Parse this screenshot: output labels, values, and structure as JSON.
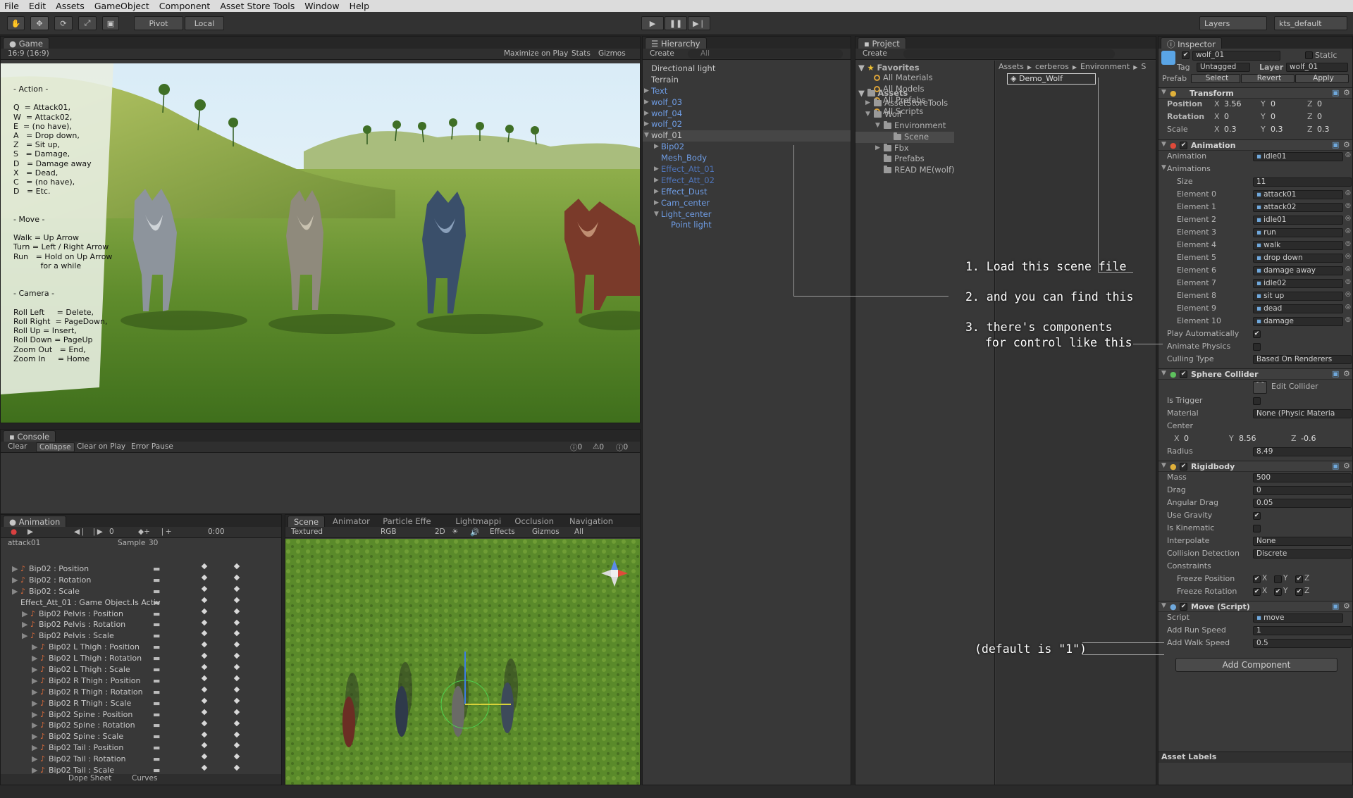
{
  "menu": [
    "File",
    "Edit",
    "Assets",
    "GameObject",
    "Component",
    "Asset Store Tools",
    "Window",
    "Help"
  ],
  "toolbar": {
    "pivot": "Pivot",
    "local": "Local",
    "layers": "Layers",
    "layout": "kts_default"
  },
  "game": {
    "tab": "Game",
    "aspect": "16:9 (16:9)",
    "maximize": "Maximize on Play",
    "stats": "Stats",
    "gizmos": "Gizmos",
    "overlay": [
      "- Action -",
      "",
      "Q  = Attack01,",
      "W  = Attack02,",
      "E  = (no have),",
      "A   = Drop down,",
      "Z   = Sit up,",
      "S   = Damage,",
      "D   = Damage away",
      "X   = Dead,",
      "C   = (no have),",
      "D   = Etc.",
      "",
      "",
      "- Move -",
      "",
      "Walk = Up Arrow",
      "Turn = Left / Right Arrow",
      "Run   = Hold on Up Arrow",
      "           for a while",
      "",
      "",
      "- Camera -",
      "",
      "Roll Left     = Delete,",
      "Roll Right  = PageDown,",
      "Roll Up = Insert,",
      "Roll Down = PageUp",
      "Zoom Out   = End,",
      "Zoom In     = Home"
    ]
  },
  "console": {
    "tab": "Console",
    "clear": "Clear",
    "collapse": "Collapse",
    "clear_on_play": "Clear on Play",
    "error_pause": "Error Pause",
    "counts": [
      "0",
      "0",
      "0"
    ]
  },
  "animation": {
    "tab": "Animation",
    "frame": "0",
    "time": "0:00",
    "clip": "attack01",
    "sample_label": "Sample",
    "sample": "30",
    "tracks": [
      "Bip02 : Position",
      "Bip02 : Rotation",
      "Bip02 : Scale",
      "Effect_Att_01 : Game Object.Is Activ",
      "Bip02 Pelvis : Position",
      "Bip02 Pelvis : Rotation",
      "Bip02 Pelvis : Scale",
      "Bip02 L Thigh : Position",
      "Bip02 L Thigh : Rotation",
      "Bip02 L Thigh : Scale",
      "Bip02 R Thigh : Position",
      "Bip02 R Thigh : Rotation",
      "Bip02 R Thigh : Scale",
      "Bip02 Spine : Position",
      "Bip02 Spine : Rotation",
      "Bip02 Spine : Scale",
      "Bip02 Tail : Position",
      "Bip02 Tail : Rotation",
      "Bip02 Tail : Scale"
    ],
    "dope_sheet": "Dope Sheet",
    "curves": "Curves"
  },
  "scene": {
    "tabs": [
      "Scene",
      "Animator",
      "Particle Effe",
      "Lightmappi",
      "Occlusion",
      "Navigation"
    ],
    "textured": "Textured",
    "rgb": "RGB",
    "mode2d": "2D",
    "effects": "Effects",
    "gizmos": "Gizmos",
    "search": "All"
  },
  "hierarchy": {
    "tab": "Hierarchy",
    "create": "Create",
    "search": "All",
    "items": [
      {
        "t": "Directional light",
        "d": 0,
        "c": "w"
      },
      {
        "t": "Terrain",
        "d": 0,
        "c": "w"
      },
      {
        "t": "Text",
        "d": 0,
        "c": "b",
        "a": "r"
      },
      {
        "t": "wolf_03",
        "d": 0,
        "c": "b",
        "a": "r"
      },
      {
        "t": "wolf_04",
        "d": 0,
        "c": "b",
        "a": "r"
      },
      {
        "t": "wolf_02",
        "d": 0,
        "c": "b",
        "a": "r"
      },
      {
        "t": "wolf_01",
        "d": 0,
        "c": "w",
        "a": "d",
        "sel": true
      },
      {
        "t": "Bip02",
        "d": 1,
        "c": "b",
        "a": "r"
      },
      {
        "t": "Mesh_Body",
        "d": 1,
        "c": "b"
      },
      {
        "t": "Effect_Att_01",
        "d": 1,
        "c": "d",
        "a": "r"
      },
      {
        "t": "Effect_Att_02",
        "d": 1,
        "c": "d",
        "a": "r"
      },
      {
        "t": "Effect_Dust",
        "d": 1,
        "c": "b",
        "a": "r"
      },
      {
        "t": "Cam_center",
        "d": 1,
        "c": "b",
        "a": "r"
      },
      {
        "t": "Light_center",
        "d": 1,
        "c": "b",
        "a": "d"
      },
      {
        "t": "Point light",
        "d": 2,
        "c": "b"
      }
    ]
  },
  "project": {
    "tab": "Project",
    "create": "Create",
    "search": "",
    "favorites": "Favorites",
    "fav_items": [
      "All Materials",
      "All Models",
      "All Prefabs",
      "All Scripts"
    ],
    "assets": "Assets",
    "tree": [
      {
        "t": "AssetStoreTools",
        "d": 1,
        "a": "r"
      },
      {
        "t": "Wolf",
        "d": 1,
        "a": "d"
      },
      {
        "t": "Environment",
        "d": 2,
        "a": "d"
      },
      {
        "t": "Scene",
        "d": 3,
        "sel": true
      },
      {
        "t": "Fbx",
        "d": 2,
        "a": "r"
      },
      {
        "t": "Prefabs",
        "d": 2
      },
      {
        "t": "READ ME(wolf)",
        "d": 2
      }
    ],
    "breadcrumb": [
      "Assets",
      "cerberos",
      "Environment",
      "S"
    ],
    "file": "Demo_Wolf"
  },
  "inspector": {
    "tab": "Inspector",
    "name": "wolf_01",
    "static": "Static",
    "tag_label": "Tag",
    "tag": "Untagged",
    "layer_label": "Layer",
    "layer": "wolf_01",
    "prefab_label": "Prefab",
    "select": "Select",
    "revert": "Revert",
    "apply": "Apply",
    "transform": {
      "title": "Transform",
      "rows": [
        {
          "l": "Position",
          "x": "3.56",
          "y": "0",
          "z": "0"
        },
        {
          "l": "Rotation",
          "x": "0",
          "y": "0",
          "z": "0"
        },
        {
          "l": "Scale",
          "x": "0.3",
          "y": "0.3",
          "z": "0.3"
        }
      ]
    },
    "animation": {
      "title": "Animation",
      "anim_label": "Animation",
      "anim": "idle01",
      "anims_label": "Animations",
      "size_label": "Size",
      "size": "11",
      "elements": [
        [
          "Element 0",
          "attack01"
        ],
        [
          "Element 1",
          "attack02"
        ],
        [
          "Element 2",
          "idle01"
        ],
        [
          "Element 3",
          "run"
        ],
        [
          "Element 4",
          "walk"
        ],
        [
          "Element 5",
          "drop down"
        ],
        [
          "Element 6",
          "damage away"
        ],
        [
          "Element 7",
          "idle02"
        ],
        [
          "Element 8",
          "sit up"
        ],
        [
          "Element 9",
          "dead"
        ],
        [
          "Element 10",
          "damage"
        ]
      ],
      "play_auto": "Play Automatically",
      "animate_physics": "Animate Physics",
      "culling_label": "Culling Type",
      "culling": "Based On Renderers"
    },
    "sphere": {
      "title": "Sphere Collider",
      "edit": "Edit Collider",
      "trigger": "Is Trigger",
      "material_label": "Material",
      "material": "None (Physic Materia",
      "center_label": "Center",
      "cx": "0",
      "cy": "8.56",
      "cz": "-0.6",
      "radius_label": "Radius",
      "radius": "8.49"
    },
    "rigidbody": {
      "title": "Rigidbody",
      "rows": [
        [
          "Mass",
          "500"
        ],
        [
          "Drag",
          "0"
        ],
        [
          "Angular Drag",
          "0.05"
        ]
      ],
      "gravity": "Use Gravity",
      "kinematic": "Is Kinematic",
      "interp_label": "Interpolate",
      "interp": "None",
      "coll_label": "Collision Detection",
      "coll": "Discrete",
      "constraints": "Constraints",
      "fpos": "Freeze Position",
      "frot": "Freeze Rotation"
    },
    "move": {
      "title": "Move (Script)",
      "script_label": "Script",
      "script": "move",
      "run_label": "Add Run Speed",
      "run": "1",
      "walk_label": "Add Walk Speed",
      "walk": "0.5"
    },
    "add_component": "Add Component",
    "asset_labels": "Asset Labels"
  },
  "annotations": {
    "a1": "1. Load this scene file",
    "a2": "2. and you can find this",
    "a3a": "3. there's components",
    "a3b": "for control like this",
    "a4": "(default is \"1\")"
  }
}
